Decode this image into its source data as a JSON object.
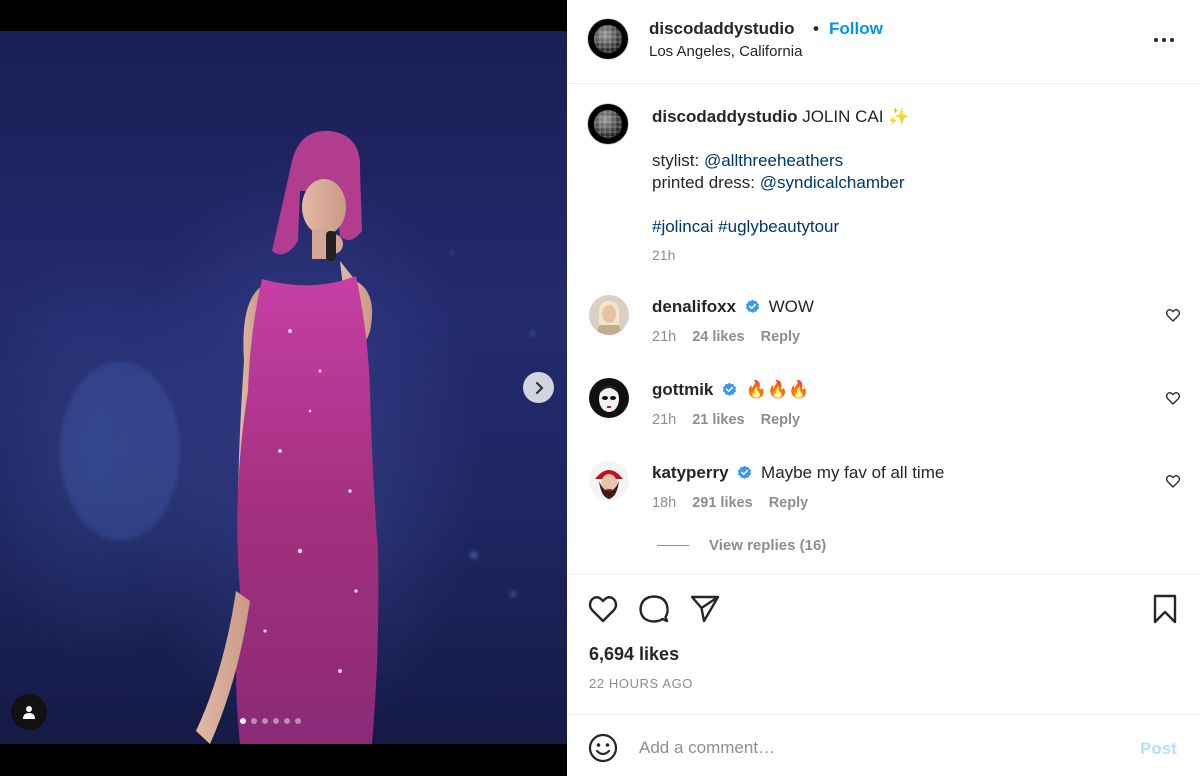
{
  "post": {
    "username": "discodaddystudio",
    "separator": "•",
    "follow_label": "Follow",
    "location": "Los Angeles, California",
    "more_icon": "more-horizontal-icon"
  },
  "caption": {
    "username": "discodaddystudio",
    "title": "JOLIN CAI",
    "sparkle": "✨",
    "stylist_label": "stylist:",
    "stylist_handle": "@allthreeheathers",
    "dress_label": "printed dress:",
    "dress_handle": "@syndicalchamber",
    "hashtag1": "#jolincai",
    "hashtag2": "#uglybeautytour",
    "time": "21h"
  },
  "comments": [
    {
      "username": "denalifoxx",
      "verified": true,
      "text": "WOW",
      "time": "21h",
      "likes": "24 likes",
      "reply": "Reply"
    },
    {
      "username": "gottmik",
      "verified": true,
      "text": "🔥🔥🔥",
      "time": "21h",
      "likes": "21 likes",
      "reply": "Reply"
    },
    {
      "username": "katyperry",
      "verified": true,
      "text": "Maybe my fav of all time",
      "time": "18h",
      "likes": "291 likes",
      "reply": "Reply"
    }
  ],
  "view_replies": "View replies (16)",
  "engagement": {
    "likes": "6,694 likes",
    "posted": "22 HOURS AGO"
  },
  "composer": {
    "placeholder": "Add a comment…",
    "post_label": "Post"
  },
  "carousel": {
    "slide_count": 6,
    "active_index": 0
  },
  "colors": {
    "accent": "#0095f6",
    "link": "#00376b",
    "muted": "#8e8e8e",
    "verified": "#3897f0",
    "post_disabled": "#b2dffc"
  }
}
